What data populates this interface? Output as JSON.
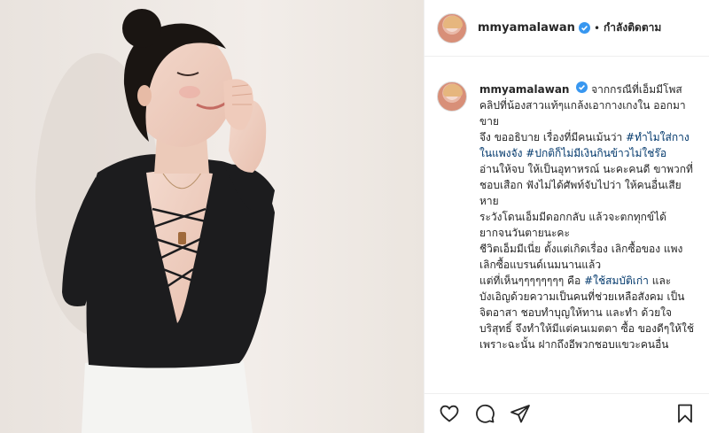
{
  "post": {
    "username": "mmyamalawan",
    "follow_status": "กำลังติดตาม",
    "separator": "•"
  },
  "caption": {
    "username": "mmyamalawan",
    "lines": [
      "จากกรณีที่เอ็มมีโพส คลิปที่น้องสาวแท้ๆแกล้งเอากางเกงใน ออกมาขาย",
      "จึง ขออธิบาย เรื่องที่มีคนเม้นว่า ",
      "อ่านให้จบ ให้เป็นอุทาหรณ์ นะคะคนดี ขาพวกที่ชอบเสือก ฟังไม่ได้ศัพท์จับไปว่า ให้คนอื่นเสียหาย",
      "ระวังโดนเอ็มมีดอกกลับ แล้วจะตกทุกข์ได้ ยากจนวันตายนะคะ",
      "ชีวิตเอ็มมีเนี่ย ตั้งแต่เกิดเรื่อง เลิกซื้อของ แพง เลิกซื้อแบรนด์เนมนานแล้ว",
      "แต่ที่เห็นๆๆๆๆๆๆๆๆ คือ ",
      " และ บังเอิญด้วยความเป็นคนที่ช่วยเหลือสังคม เป็นจิตอาสา ชอบทำบุญให้ทาน และทำ ด้วยใจบริสุทธิ์ จึงทำให้มีแต่คนเมตตา ซื้อ ของดีๆให้ใช้",
      "เพราะฉะนั้น ฝากถึงอีพวกชอบแขวะคนอื่น"
    ],
    "hashtags": {
      "h1": "#ทำไมใส่กางในแพงจัง",
      "h2": "#ปกติก็ไม่มีเงินกินข้าวไม่ใช่ร๊อ",
      "h3": "#ใช้สมบัติเก่า"
    }
  },
  "actions": {
    "like": "heart-icon",
    "comment": "comment-icon",
    "share": "share-icon",
    "save": "bookmark-icon"
  },
  "colors": {
    "text": "#262626",
    "hashtag": "#00376b",
    "verified": "#3897f0",
    "border": "#efefef"
  }
}
